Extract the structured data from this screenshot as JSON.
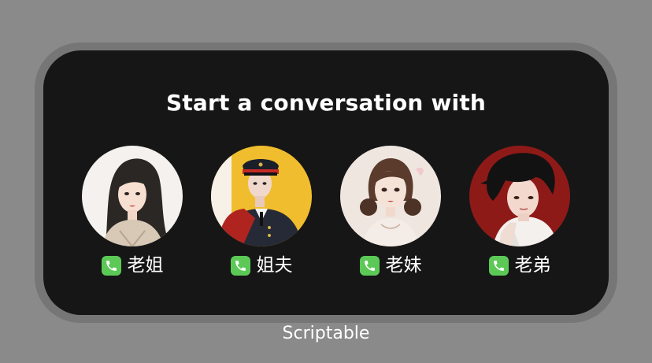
{
  "widget": {
    "title": "Start a conversation with",
    "contacts": [
      {
        "name": "老姐",
        "icon": "phone-icon",
        "avatar": "avatar-illustration-woman-long-hair"
      },
      {
        "name": "姐夫",
        "icon": "phone-icon",
        "avatar": "avatar-illustration-man-uniform"
      },
      {
        "name": "老妹",
        "icon": "phone-icon",
        "avatar": "avatar-illustration-girl-buns"
      },
      {
        "name": "老弟",
        "icon": "phone-icon",
        "avatar": "avatar-illustration-boy-dark-hair"
      }
    ]
  },
  "app": {
    "caption": "Scriptable"
  },
  "colors": {
    "background": "#8a8a8a",
    "widget_background": "#161616",
    "text": "#ffffff",
    "call_icon": "#5cc957"
  }
}
